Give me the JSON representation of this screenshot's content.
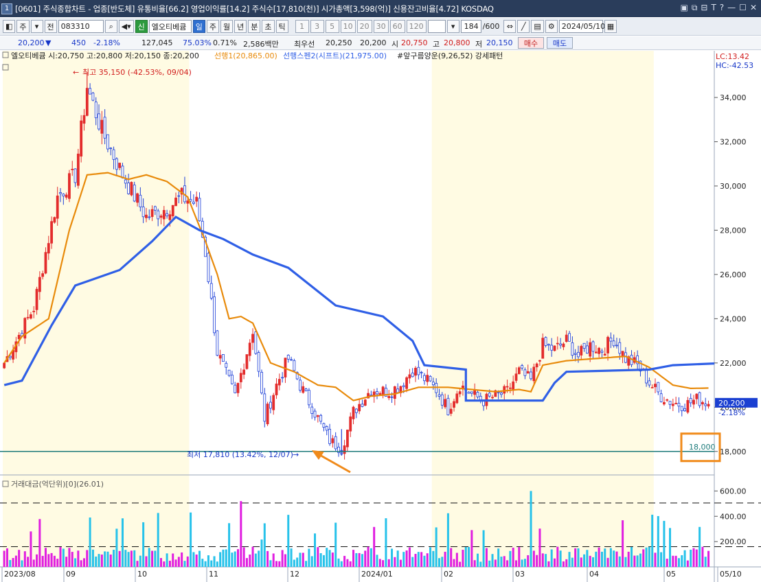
{
  "window": {
    "num": "1",
    "title": "[0601] 주식종합차트 - 업종[반도체] 유통비율[66.2] 영업이익률[14.2] 주식수[17,810(천)] 시가총액[3,598(억)] 신용잔고비율[4.72] KOSDAQ"
  },
  "toolbar": {
    "period": "주",
    "prev": "전",
    "code": "083310",
    "badge": "신",
    "name": "엘오티베큠",
    "tabs": [
      "일",
      "주",
      "월",
      "년",
      "분",
      "초",
      "틱"
    ],
    "intervals": [
      "1",
      "3",
      "5",
      "10",
      "20",
      "30",
      "60",
      "120"
    ],
    "count": "184",
    "total": "/600",
    "date": "2024/05/10"
  },
  "quote": {
    "price": "20,200",
    "arrow": "▼",
    "change": "450",
    "pct": "-2.18%",
    "volume": "127,045",
    "vol_ratio": "75.03%",
    "turnover": "0.71%",
    "amount": "2,586백만",
    "priority_label": "최우선",
    "ask": "20,250",
    "bid": "20,200",
    "open_label": "시",
    "open": "20,750",
    "high_label": "고",
    "high": "20,800",
    "low_label": "저",
    "low": "20,150",
    "buy": "매수",
    "sell": "매도"
  },
  "legend": {
    "stock": "엘오티베큠 시:20,750 고:20,800 저:20,150 종:20,200",
    "lead1": "선행1(20,865.00)",
    "lead2": "선행스펜2(시프트)(21,975.00)",
    "cloud": "#앞구름양운(9,26,52) 강세패턴",
    "lc": "LC:13.42",
    "hc": "HC:-42.53"
  },
  "annotations": {
    "high": "최고 35,150 (-42.53%, 09/04)",
    "low": "최저 17,810 (13.42%, 12/07)",
    "level": "18,000",
    "current": "20,200",
    "current_pct": "-2.18%"
  },
  "volume_panel": {
    "title": "거래대금(억단위)[0](26.01)"
  },
  "colors": {
    "up": "#e32c2c",
    "down": "#1d3fd8",
    "lead1": "#e88a0a",
    "lead2": "#2f5fe6",
    "teal": "#1c7a7a",
    "highlight": "#f08a1a",
    "vol_up": "#e01ee0",
    "vol_down": "#27c2ea"
  },
  "chart_data": {
    "type": "candlestick",
    "y_range": [
      17000,
      35800
    ],
    "y_ticks": [
      18000,
      20000,
      22000,
      24000,
      26000,
      28000,
      30000,
      32000,
      34000
    ],
    "y_tick_labels": [
      "18,000",
      "20,000",
      "22,000",
      "24,000",
      "26,000",
      "28,000",
      "30,000",
      "32,000",
      "34,000"
    ],
    "x_labels": [
      "2023/08",
      "09",
      "10",
      "11",
      "12",
      "2024/01",
      "02",
      "03",
      "04",
      "05",
      "05/10"
    ],
    "high": 35150,
    "low": 17810,
    "horizontal_line": 18000,
    "last_close": 20200,
    "vol_range": [
      0,
      640
    ],
    "vol_ticks": [
      200,
      400,
      600
    ],
    "vol_tick_labels": [
      "200.00",
      "400.00",
      "600.00"
    ],
    "vol_dashed_levels": [
      160,
      505
    ],
    "anchors": [
      [
        0,
        22000
      ],
      [
        10,
        24500
      ],
      [
        18,
        29500
      ],
      [
        24,
        30500
      ],
      [
        28,
        34500
      ],
      [
        33,
        32500
      ],
      [
        40,
        30500
      ],
      [
        48,
        28600
      ],
      [
        55,
        29000
      ],
      [
        60,
        29500
      ],
      [
        65,
        29200
      ],
      [
        68,
        27000
      ],
      [
        72,
        22500
      ],
      [
        78,
        20500
      ],
      [
        84,
        23500
      ],
      [
        88,
        19500
      ],
      [
        92,
        21000
      ],
      [
        96,
        22200
      ],
      [
        100,
        21000
      ],
      [
        106,
        19500
      ],
      [
        110,
        18500
      ],
      [
        114,
        18100
      ],
      [
        118,
        19800
      ],
      [
        124,
        20800
      ],
      [
        130,
        20700
      ],
      [
        134,
        21000
      ],
      [
        138,
        21700
      ],
      [
        142,
        21300
      ],
      [
        146,
        20800
      ],
      [
        150,
        19900
      ],
      [
        154,
        21000
      ],
      [
        158,
        20600
      ],
      [
        162,
        20300
      ],
      [
        166,
        20500
      ],
      [
        170,
        20700
      ],
      [
        174,
        21600
      ],
      [
        178,
        21200
      ],
      [
        182,
        22800
      ],
      [
        186,
        22600
      ],
      [
        190,
        23000
      ],
      [
        194,
        22300
      ],
      [
        198,
        22800
      ],
      [
        202,
        22600
      ],
      [
        206,
        23100
      ],
      [
        210,
        22200
      ],
      [
        214,
        21900
      ],
      [
        218,
        21100
      ],
      [
        222,
        20500
      ],
      [
        226,
        20200
      ],
      [
        230,
        20100
      ],
      [
        234,
        20350
      ],
      [
        238,
        20200
      ]
    ],
    "lead1_anchors": [
      [
        0,
        22000
      ],
      [
        6,
        23200
      ],
      [
        15,
        24000
      ],
      [
        22,
        28000
      ],
      [
        28,
        30500
      ],
      [
        35,
        30600
      ],
      [
        42,
        30300
      ],
      [
        48,
        30500
      ],
      [
        55,
        30200
      ],
      [
        62,
        29500
      ],
      [
        68,
        27500
      ],
      [
        72,
        26000
      ],
      [
        76,
        24000
      ],
      [
        80,
        24100
      ],
      [
        84,
        23800
      ],
      [
        90,
        22000
      ],
      [
        98,
        21600
      ],
      [
        106,
        21000
      ],
      [
        112,
        20900
      ],
      [
        118,
        20300
      ],
      [
        124,
        20500
      ],
      [
        132,
        20600
      ],
      [
        140,
        20900
      ],
      [
        150,
        20900
      ],
      [
        158,
        20800
      ],
      [
        166,
        20700
      ],
      [
        174,
        20800
      ],
      [
        178,
        20700
      ],
      [
        182,
        21900
      ],
      [
        190,
        22100
      ],
      [
        200,
        22200
      ],
      [
        210,
        22300
      ],
      [
        218,
        21800
      ],
      [
        226,
        21000
      ],
      [
        232,
        20850
      ],
      [
        238,
        20865
      ]
    ],
    "lead2_steps": [
      [
        0,
        21000
      ],
      [
        6,
        21200
      ],
      [
        16,
        23700
      ],
      [
        24,
        25500
      ],
      [
        39,
        26200
      ],
      [
        50,
        27500
      ],
      [
        58,
        28600
      ],
      [
        66,
        28000
      ],
      [
        74,
        27600
      ],
      [
        84,
        26900
      ],
      [
        96,
        26300
      ],
      [
        112,
        24600
      ],
      [
        128,
        24100
      ],
      [
        138,
        23000
      ],
      [
        142,
        21900
      ],
      [
        156,
        21700
      ],
      [
        156,
        20300
      ],
      [
        182,
        20300
      ],
      [
        186,
        21100
      ],
      [
        190,
        21600
      ],
      [
        218,
        21700
      ],
      [
        226,
        21900
      ],
      [
        240,
        21975
      ]
    ],
    "bar_count": 240,
    "shaded_ranges": [
      [
        0,
        63
      ],
      [
        145,
        220
      ]
    ]
  }
}
